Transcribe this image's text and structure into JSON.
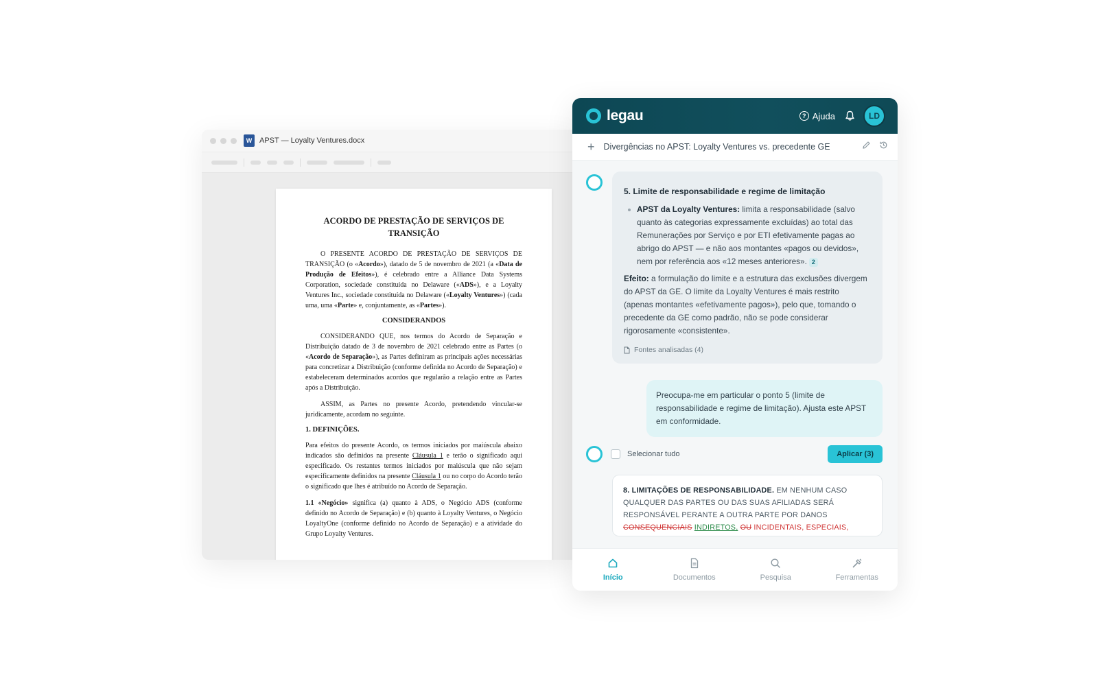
{
  "word": {
    "filename": "APST — Loyalty Ventures.docx",
    "logo_letter": "W",
    "doc": {
      "title": "ACORDO DE PRESTAÇÃO DE SERVIÇOS DE TRANSIÇÃO",
      "p1_a": "O PRESENTE ACORDO DE PRESTAÇÃO DE SERVIÇOS DE TRANSIÇÃO (o «",
      "p1_b": "Acordo",
      "p1_c": "»), datado de 5 de novembro de 2021 (a «",
      "p1_d": "Data de Produção de Efeitos",
      "p1_e": "»), é celebrado entre a Alliance Data Systems Corporation, sociedade constituída no Delaware («",
      "p1_f": "ADS",
      "p1_g": "»), e a Loyalty Ventures Inc., sociedade constituída no Delaware («",
      "p1_h": "Loyalty Ventures",
      "p1_i": "») (cada uma, uma «",
      "p1_j": "Parte",
      "p1_k": "» e, conjuntamente, as «",
      "p1_l": "Partes",
      "p1_m": "»).",
      "considerandos": "CONSIDERANDOS",
      "p2_a": "CONSIDERANDO QUE, nos termos do Acordo de Separação e Distribuição datado de 3 de novembro de 2021 celebrado entre as Partes (o «",
      "p2_b": "Acordo de Separação",
      "p2_c": "»), as Partes definiram as principais ações necessárias para concretizar a Distribuição (conforme definida no Acordo de Separação) e estabeleceram determinados acordos que regularão a relação entre as Partes após a Distribuição.",
      "p3": "ASSIM, as Partes no presente Acordo, pretendendo vincular-se juridicamente, acordam no seguinte.",
      "sec1": "1.   DEFINIÇÕES.",
      "p4_a": "Para efeitos do presente Acordo, os termos iniciados por maiúscula abaixo indicados são definidos na presente ",
      "p4_link1": "Cláusula 1",
      "p4_b": " e terão o significado aqui especificado. Os restantes termos iniciados por maiúscula que não sejam especificamente definidos na presente ",
      "p4_link2": "Cláusula 1",
      "p4_c": " ou no corpo do Acordo terão o significado que lhes é atribuído no Acordo de Separação.",
      "p5_a": "1.1 «Negócio»",
      "p5_b": " significa (a) quanto à ADS, o Negócio ADS (conforme definido no Acordo de Separação) e (b) quanto à Loyalty Ventures, o Negócio LoyaltyOne (conforme definido no Acordo de Separação) e a atividade do Grupo Loyalty Ventures."
    }
  },
  "app": {
    "brand": "legau",
    "help_label": "Ajuda",
    "avatar_initials": "LD",
    "conversation_title": "Divergências no APST: Loyalty Ventures vs. precedente GE",
    "ai": {
      "heading": "5.  Limite de responsabilidade e regime de limitação",
      "bullet_bold": "APST da Loyalty Ventures:",
      "bullet_text": " limita a responsabilidade (salvo quanto às categorias expressamente excluídas) ao total das Remunerações por Serviço e por ETI efetivamente pagas ao abrigo do APST — e não aos montantes «pagos ou devidos», nem por referência aos «12 meses anteriores».",
      "citation": "2",
      "effect_bold": "Efeito:",
      "effect_text": " a formulação do limite e a estrutura das exclusões divergem do APST da GE. O limite da Loyalty Ventures é mais restrito (apenas montantes «efetivamente pagos»), pelo que, tomando o precedente da GE como padrão, não se pode considerar rigorosamente «consistente».",
      "sources_label": "Fontes analisadas (4)"
    },
    "user_message": "Preocupa-me em particular o ponto 5 (limite de responsabilidade e regime de limitação). Ajusta este APST em conformidade.",
    "select_all_label": "Selecionar tudo",
    "apply_label": "Aplicar (3)",
    "clause": {
      "bold": "8.  LIMITAÇÕES DE RESPONSABILIDADE.",
      "text1": " EM NENHUM CASO QUALQUER DAS PARTES OU DAS SUAS AFILIADAS SERÁ RESPONSÁVEL PERANTE A OUTRA PARTE POR DANOS ",
      "deleted1": "CONSEQUENCIAIS",
      "inserted1": "INDIRETOS,",
      "deleted2": "OU",
      "text2": " INCIDENTAIS, ESPECIAIS, EXEMPLARES PUNITIVOS OU CONSEQUENCIAIS"
    },
    "nav": [
      {
        "label": "Início"
      },
      {
        "label": "Documentos"
      },
      {
        "label": "Pesquisa"
      },
      {
        "label": "Ferramentas"
      }
    ]
  },
  "colors": {
    "accent": "#29c3d6",
    "header_bg": "#0d4754",
    "deleted": "#d03535",
    "inserted": "#2a8a48",
    "word_blue": "#2a5699"
  }
}
